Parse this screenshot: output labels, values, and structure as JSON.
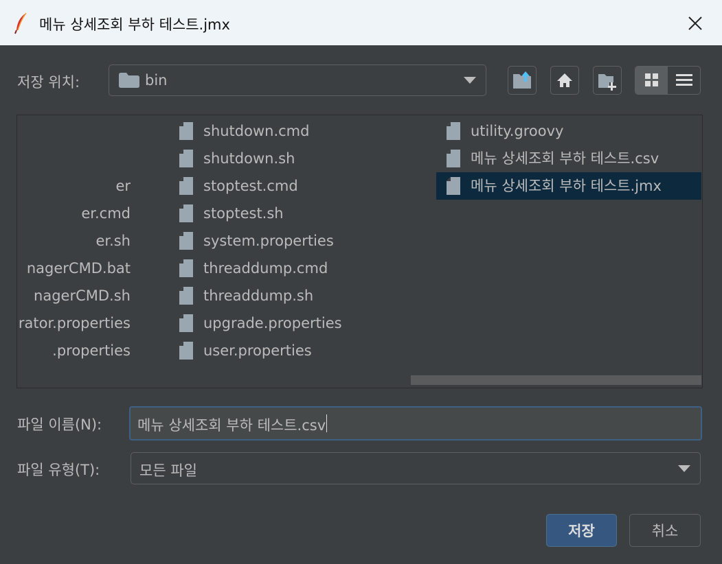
{
  "window": {
    "title": "메뉴 상세조회 부하 테스트.jmx"
  },
  "location": {
    "label": "저장 위치:",
    "current_folder": "bin"
  },
  "toolbar": {
    "up_folder": "folder-up-icon",
    "home": "home-icon",
    "new_folder": "new-folder-icon",
    "list_view": "list-view-icon",
    "details_view": "details-view-icon"
  },
  "files": {
    "column1": [
      "er",
      "er.cmd",
      "er.sh",
      "nagerCMD.bat",
      "nagerCMD.sh",
      "rator.properties",
      ".properties"
    ],
    "column2": [
      "shutdown.cmd",
      "shutdown.sh",
      "stoptest.cmd",
      "stoptest.sh",
      "system.properties",
      "threaddump.cmd",
      "threaddump.sh",
      "upgrade.properties",
      "user.properties"
    ],
    "column3": [
      "utility.groovy",
      "메뉴 상세조회 부하 테스트.csv",
      "메뉴 상세조회 부하 테스트.jmx"
    ],
    "selected": "메뉴 상세조회 부하 테스트.jmx"
  },
  "filename": {
    "label": "파일 이름(N):",
    "value": "메뉴 상세조회 부하 테스트.csv"
  },
  "filetype": {
    "label": "파일 유형(T):",
    "value": "모든 파일"
  },
  "buttons": {
    "save": "저장",
    "cancel": "취소"
  },
  "colors": {
    "background": "#3c3f41",
    "selection": "#0d293e",
    "primary_button": "#365880",
    "accent_icon": "#4fc3f7"
  }
}
